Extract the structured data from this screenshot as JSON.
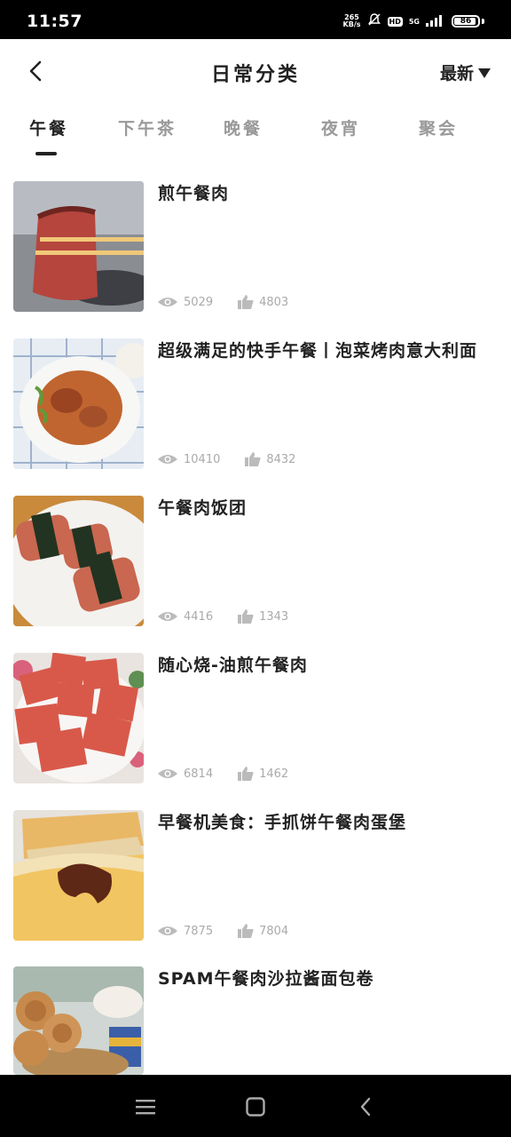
{
  "status_bar": {
    "time": "11:57",
    "net_speed_value": "265",
    "net_speed_unit": "KB/s",
    "hd": "HD",
    "network": "5G",
    "battery": "86"
  },
  "header": {
    "title": "日常分类",
    "sort_label": "最新"
  },
  "tabs": [
    {
      "label": "午餐",
      "active": true
    },
    {
      "label": "下午茶",
      "active": false
    },
    {
      "label": "晚餐",
      "active": false
    },
    {
      "label": "夜宵",
      "active": false
    },
    {
      "label": "聚会",
      "active": false
    }
  ],
  "recipes": [
    {
      "title": "煎午餐肉",
      "views": "5029",
      "likes": "4803"
    },
    {
      "title": "超级满足的快手午餐丨泡菜烤肉意大利面",
      "views": "10410",
      "likes": "8432"
    },
    {
      "title": "午餐肉饭团",
      "views": "4416",
      "likes": "1343"
    },
    {
      "title": "随心烧-油煎午餐肉",
      "views": "6814",
      "likes": "1462"
    },
    {
      "title": "早餐机美食：手抓饼午餐肉蛋堡",
      "views": "7875",
      "likes": "7804"
    },
    {
      "title": "SPAM午餐肉沙拉酱面包卷"
    }
  ]
}
